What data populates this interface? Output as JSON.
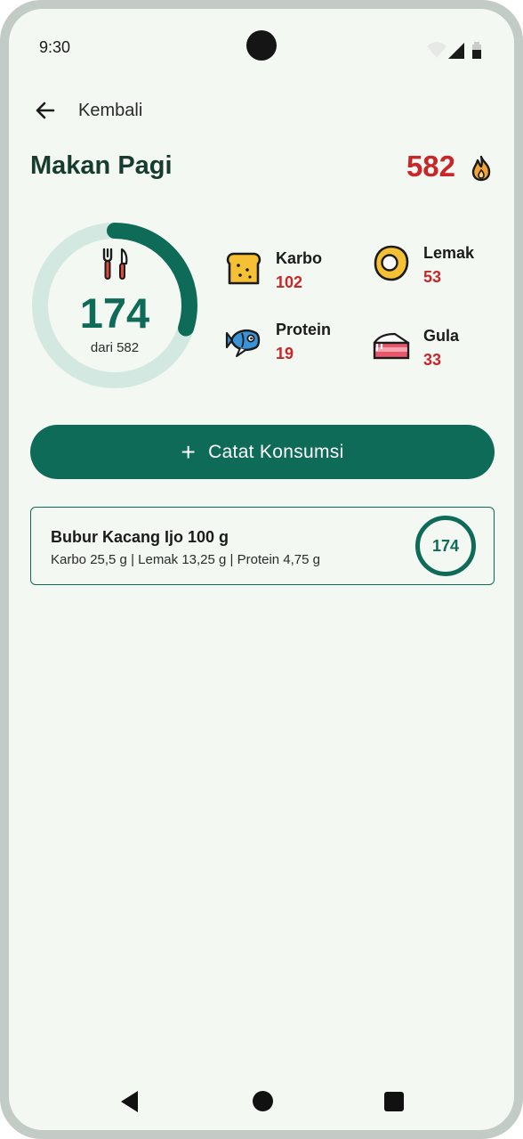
{
  "status_bar": {
    "time": "9:30",
    "icons": [
      "wifi-icon",
      "signal-icon",
      "battery-icon"
    ]
  },
  "header": {
    "back_label": "Kembali",
    "meal_title": "Makan Pagi",
    "target_calories": "582",
    "icon": "flame-icon"
  },
  "summary": {
    "consumed": "174",
    "of_label": "dari 582",
    "progress": 0.299,
    "icon": "utensils-icon"
  },
  "macros": [
    {
      "name": "Karbo",
      "value": "102",
      "icon": "bread-icon"
    },
    {
      "name": "Lemak",
      "value": "53",
      "icon": "fried-egg-icon"
    },
    {
      "name": "Protein",
      "value": "19",
      "icon": "fish-icon"
    },
    {
      "name": "Gula",
      "value": "33",
      "icon": "cake-icon"
    }
  ],
  "add_button": {
    "plus": "+",
    "label": "Catat Konsumsi"
  },
  "food_items": [
    {
      "name": "Bubur Kacang Ijo 100 g",
      "detail": "Karbo 25,5 g | Lemak 13,25 g | Protein 4,75 g",
      "calories": "174"
    }
  ],
  "colors": {
    "primary": "#0e6b57",
    "accent_red": "#c8272a",
    "ring_track": "#d3e8e0",
    "background": "#f3f8f3"
  },
  "nav_bar": {
    "icons": [
      "nav-back-icon",
      "nav-home-icon",
      "nav-recent-icon"
    ]
  }
}
